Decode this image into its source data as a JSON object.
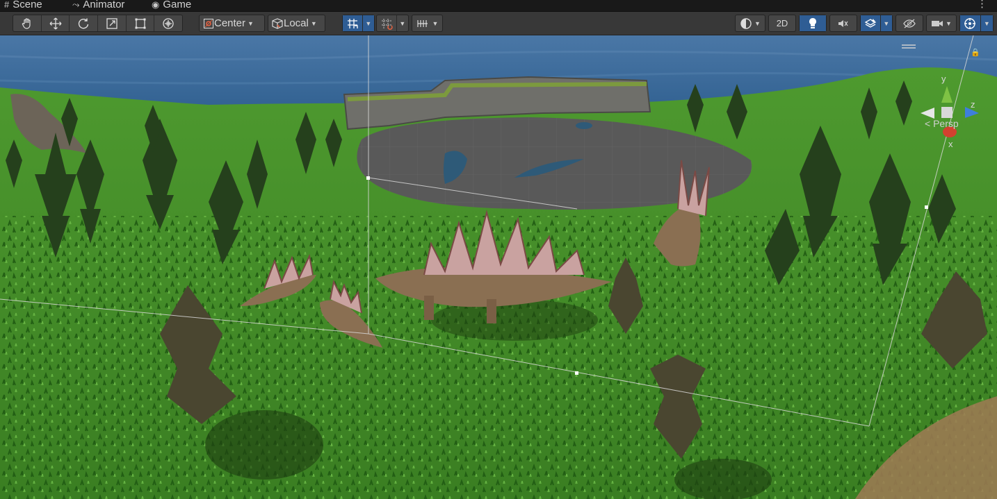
{
  "tabs": [
    {
      "label": "Scene",
      "icon": "hash-icon"
    },
    {
      "label": "Animator",
      "icon": "animator-icon"
    },
    {
      "label": "Game",
      "icon": "gamepad-icon"
    }
  ],
  "toolbar": {
    "tools": [
      "hand-tool",
      "move-tool",
      "rotate-tool",
      "scale-tool",
      "rect-tool",
      "transform-tool"
    ],
    "pivot_label": "Center",
    "space_label": "Local",
    "toggle_2d_label": "2D"
  },
  "viewport": {
    "projection_label": "< Persp",
    "axis_labels": {
      "y": "y",
      "z": "z",
      "x": "x"
    }
  },
  "colors": {
    "accent": "#2f5d94",
    "sky": "#3d6a96",
    "grass": "#3f8a2a",
    "pond": "#5a5a5a",
    "axis_x": "#d2412f",
    "axis_y": "#7fc244",
    "axis_z": "#3e7fdc"
  }
}
